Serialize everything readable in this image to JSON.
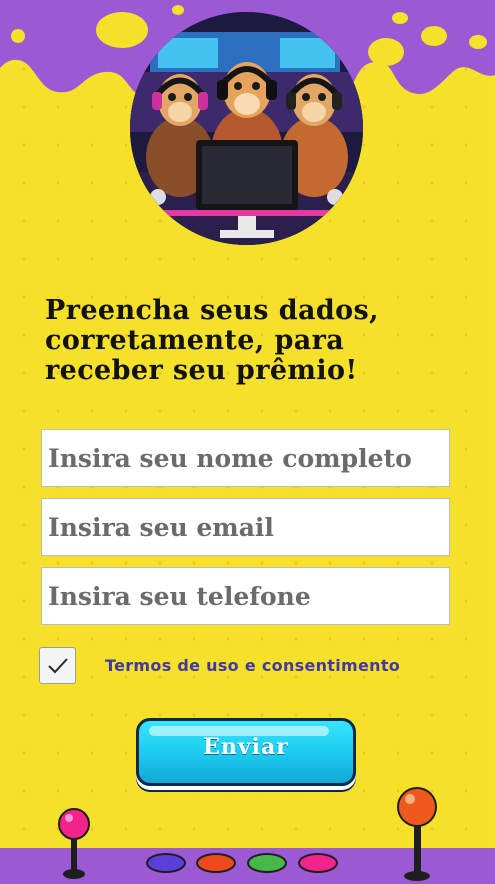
{
  "colors": {
    "background": "#f6e12a",
    "accent_purple": "#9b5ad3",
    "terms_text": "#4437a6",
    "button_cyan": "#1cc9ef"
  },
  "hero": {
    "image_icon": "meerkat-gamers-illustration"
  },
  "form": {
    "headline": "Preencha seus dados, corretamente, para receber seu prêmio!",
    "name_placeholder": "Insira seu nome completo",
    "email_placeholder": "Insira seu email",
    "phone_placeholder": "Insira seu telefone",
    "terms_checked": true,
    "terms_label": "Termos de uso e consentimento",
    "submit_label": "Enviar"
  },
  "decor": {
    "arcade_button_colors": [
      "#5b3fd8",
      "#ee4a1e",
      "#46b848",
      "#f2238a"
    ]
  }
}
